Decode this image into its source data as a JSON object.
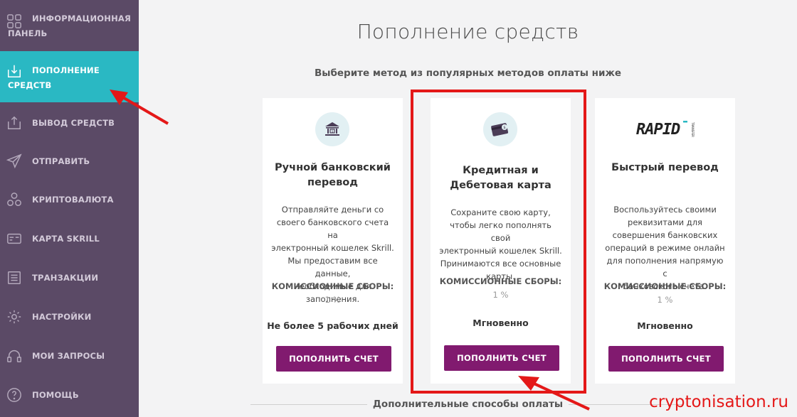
{
  "sidebar": {
    "items": [
      {
        "label": "Информационная панель",
        "icon": "grid-icon"
      },
      {
        "label": "Пополнение средств",
        "icon": "download-tray-icon",
        "active": true
      },
      {
        "label": "Вывод средств",
        "icon": "upload-tray-icon"
      },
      {
        "label": "Отправить",
        "icon": "paper-plane-icon"
      },
      {
        "label": "Криптовалюта",
        "icon": "crypto-nodes-icon"
      },
      {
        "label": "Карта Skrill",
        "icon": "card-icon"
      },
      {
        "label": "Транзакции",
        "icon": "transactions-list-icon"
      },
      {
        "label": "Настройки",
        "icon": "gear-icon"
      },
      {
        "label": "Мои запросы",
        "icon": "headset-icon"
      },
      {
        "label": "Помощь",
        "icon": "question-icon"
      }
    ]
  },
  "main": {
    "title": "Пополнение средств",
    "subtitle": "Выберите метод из популярных методов оплаты ниже",
    "cards": [
      {
        "icon": "bank-icon",
        "title_line1": "Ручной банковский",
        "title_line2": "перевод",
        "desc": [
          "Отправляйте деньги со",
          "своего банковского счета на",
          "электронный кошелек Skrill.",
          "Мы предоставим все данные,",
          "необходимые для",
          "заполнения."
        ],
        "fee_label": "КОМИССИОННЫЕ СБОРЫ:",
        "fee_value": "1 %",
        "time": "Не более 5 рабочих дней",
        "button": "ПОПОЛНИТЬ СЧЕТ"
      },
      {
        "icon": "credit-card-icon",
        "title_line1": "Кредитная и",
        "title_line2": "Дебетовая карта",
        "desc": [
          "Сохраните свою карту,",
          "чтобы легко пополнять свой",
          "электронный кошелек Skrill.",
          "Принимаются все основные",
          "карты."
        ],
        "fee_label": "КОМИССИОННЫЕ СБОРЫ:",
        "fee_value": "1 %",
        "time": "Мгновенно",
        "button": "ПОПОЛНИТЬ СЧЕТ"
      },
      {
        "icon": "rapid-transfer-logo",
        "logo_text": "RAPID",
        "logo_small": "TRANSFER",
        "title_line1": "Быстрый перевод",
        "desc": [
          "Воспользуйтесь своими",
          "реквизитами для",
          "совершения банковских",
          "операций в режиме онлайн",
          "для пополнения напрямую с",
          "банковского счета."
        ],
        "fee_label": "КОМИССИОННЫЕ СБОРЫ:",
        "fee_value": "1 %",
        "time": "Мгновенно",
        "button": "ПОПОЛНИТЬ СЧЕТ"
      }
    ],
    "bottom_heading": "Дополнительные способы оплаты"
  },
  "watermark": "cryptonisation.ru",
  "colors": {
    "sidebar_bg": "#5b4a66",
    "active_bg": "#2ab8c3",
    "button_bg": "#811a6f",
    "highlight_red": "#e41818"
  }
}
